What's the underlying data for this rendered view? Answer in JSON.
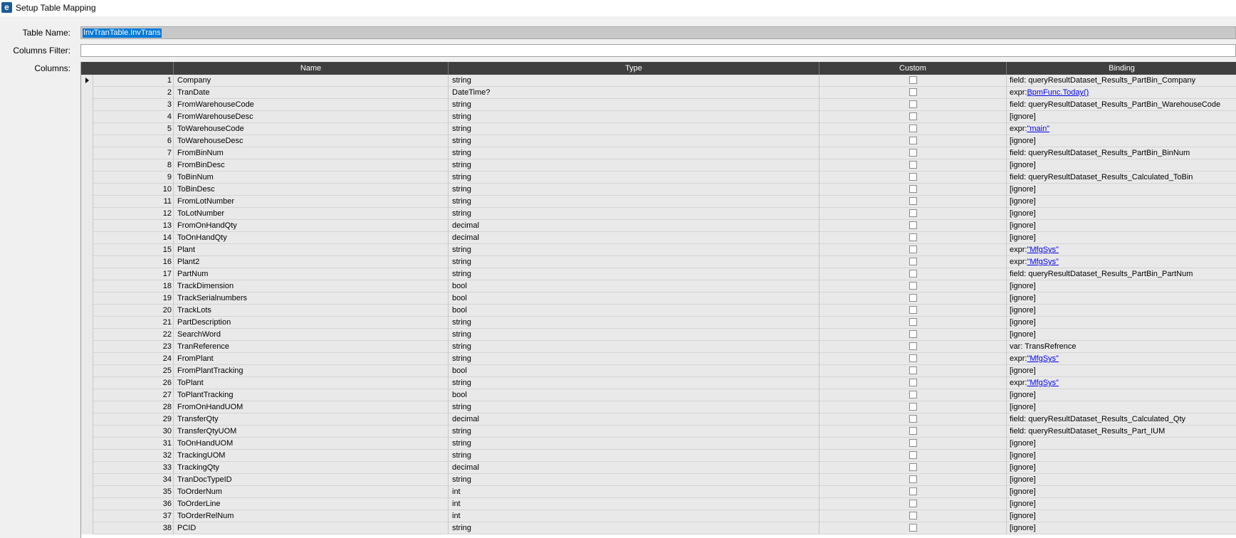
{
  "window": {
    "title": "Setup Table Mapping",
    "icon": "epicor-e-icon"
  },
  "form": {
    "table_name_label": "Table Name:",
    "table_name_value": "InvTranTable.InvTrans",
    "columns_filter_label": "Columns Filter:",
    "columns_filter_value": "",
    "columns_label": "Columns:"
  },
  "grid": {
    "headers": {
      "name": "Name",
      "type": "Type",
      "custom": "Custom",
      "binding": "Binding"
    },
    "rows": [
      {
        "num": "1",
        "name": "Company",
        "type": "string",
        "bind_prefix": "field: queryResultDataset_Results_PartBin_Company",
        "bind_link": ""
      },
      {
        "num": "2",
        "name": "TranDate",
        "type": "DateTime?",
        "bind_prefix": "expr:",
        "bind_link": "BpmFunc.Today()"
      },
      {
        "num": "3",
        "name": "FromWarehouseCode",
        "type": "string",
        "bind_prefix": "field: queryResultDataset_Results_PartBin_WarehouseCode",
        "bind_link": ""
      },
      {
        "num": "4",
        "name": "FromWarehouseDesc",
        "type": "string",
        "bind_prefix": "[ignore]",
        "bind_link": ""
      },
      {
        "num": "5",
        "name": "ToWarehouseCode",
        "type": "string",
        "bind_prefix": "expr:",
        "bind_link": "\"main\""
      },
      {
        "num": "6",
        "name": "ToWarehouseDesc",
        "type": "string",
        "bind_prefix": "[ignore]",
        "bind_link": ""
      },
      {
        "num": "7",
        "name": "FromBinNum",
        "type": "string",
        "bind_prefix": "field: queryResultDataset_Results_PartBin_BinNum",
        "bind_link": ""
      },
      {
        "num": "8",
        "name": "FromBinDesc",
        "type": "string",
        "bind_prefix": "[ignore]",
        "bind_link": ""
      },
      {
        "num": "9",
        "name": "ToBinNum",
        "type": "string",
        "bind_prefix": "field: queryResultDataset_Results_Calculated_ToBin",
        "bind_link": ""
      },
      {
        "num": "10",
        "name": "ToBinDesc",
        "type": "string",
        "bind_prefix": "[ignore]",
        "bind_link": ""
      },
      {
        "num": "11",
        "name": "FromLotNumber",
        "type": "string",
        "bind_prefix": "[ignore]",
        "bind_link": ""
      },
      {
        "num": "12",
        "name": "ToLotNumber",
        "type": "string",
        "bind_prefix": "[ignore]",
        "bind_link": ""
      },
      {
        "num": "13",
        "name": "FromOnHandQty",
        "type": "decimal",
        "bind_prefix": "[ignore]",
        "bind_link": ""
      },
      {
        "num": "14",
        "name": "ToOnHandQty",
        "type": "decimal",
        "bind_prefix": "[ignore]",
        "bind_link": ""
      },
      {
        "num": "15",
        "name": "Plant",
        "type": "string",
        "bind_prefix": "expr:",
        "bind_link": "\"MfgSys\""
      },
      {
        "num": "16",
        "name": "Plant2",
        "type": "string",
        "bind_prefix": "expr:",
        "bind_link": "\"MfgSys\""
      },
      {
        "num": "17",
        "name": "PartNum",
        "type": "string",
        "bind_prefix": "field: queryResultDataset_Results_PartBin_PartNum",
        "bind_link": ""
      },
      {
        "num": "18",
        "name": "TrackDimension",
        "type": "bool",
        "bind_prefix": "[ignore]",
        "bind_link": ""
      },
      {
        "num": "19",
        "name": "TrackSerialnumbers",
        "type": "bool",
        "bind_prefix": "[ignore]",
        "bind_link": ""
      },
      {
        "num": "20",
        "name": "TrackLots",
        "type": "bool",
        "bind_prefix": "[ignore]",
        "bind_link": ""
      },
      {
        "num": "21",
        "name": "PartDescription",
        "type": "string",
        "bind_prefix": "[ignore]",
        "bind_link": ""
      },
      {
        "num": "22",
        "name": "SearchWord",
        "type": "string",
        "bind_prefix": "[ignore]",
        "bind_link": ""
      },
      {
        "num": "23",
        "name": "TranReference",
        "type": "string",
        "bind_prefix": "var: TransRefrence",
        "bind_link": ""
      },
      {
        "num": "24",
        "name": "FromPlant",
        "type": "string",
        "bind_prefix": "expr:",
        "bind_link": "\"MfgSys\""
      },
      {
        "num": "25",
        "name": "FromPlantTracking",
        "type": "bool",
        "bind_prefix": "[ignore]",
        "bind_link": ""
      },
      {
        "num": "26",
        "name": "ToPlant",
        "type": "string",
        "bind_prefix": "expr:",
        "bind_link": "\"MfgSys\""
      },
      {
        "num": "27",
        "name": "ToPlantTracking",
        "type": "bool",
        "bind_prefix": "[ignore]",
        "bind_link": ""
      },
      {
        "num": "28",
        "name": "FromOnHandUOM",
        "type": "string",
        "bind_prefix": "[ignore]",
        "bind_link": ""
      },
      {
        "num": "29",
        "name": "TransferQty",
        "type": "decimal",
        "bind_prefix": "field: queryResultDataset_Results_Calculated_Qty",
        "bind_link": ""
      },
      {
        "num": "30",
        "name": "TransferQtyUOM",
        "type": "string",
        "bind_prefix": "field: queryResultDataset_Results_Part_IUM",
        "bind_link": ""
      },
      {
        "num": "31",
        "name": "ToOnHandUOM",
        "type": "string",
        "bind_prefix": "[ignore]",
        "bind_link": ""
      },
      {
        "num": "32",
        "name": "TrackingUOM",
        "type": "string",
        "bind_prefix": "[ignore]",
        "bind_link": ""
      },
      {
        "num": "33",
        "name": "TrackingQty",
        "type": "decimal",
        "bind_prefix": "[ignore]",
        "bind_link": ""
      },
      {
        "num": "34",
        "name": "TranDocTypeID",
        "type": "string",
        "bind_prefix": "[ignore]",
        "bind_link": ""
      },
      {
        "num": "35",
        "name": "ToOrderNum",
        "type": "int",
        "bind_prefix": "[ignore]",
        "bind_link": ""
      },
      {
        "num": "36",
        "name": "ToOrderLine",
        "type": "int",
        "bind_prefix": "[ignore]",
        "bind_link": ""
      },
      {
        "num": "37",
        "name": "ToOrderRelNum",
        "type": "int",
        "bind_prefix": "[ignore]",
        "bind_link": ""
      },
      {
        "num": "38",
        "name": "PCID",
        "type": "string",
        "bind_prefix": "[ignore]",
        "bind_link": ""
      }
    ]
  }
}
